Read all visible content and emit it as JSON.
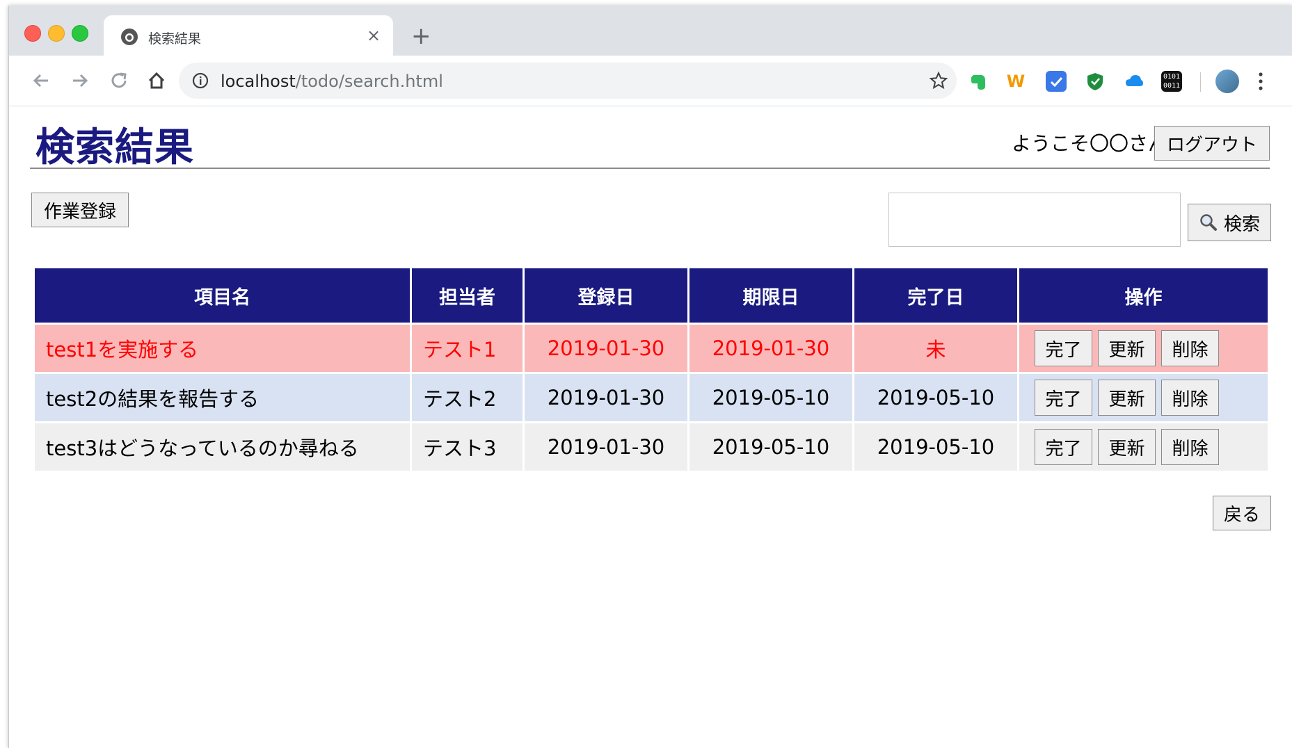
{
  "browser": {
    "tab_title": "検索結果",
    "tab_close": "×",
    "new_tab": "+",
    "url_host": "localhost",
    "url_path": "/todo/search.html",
    "ext_w_label": "W",
    "ext_binary_label": "0101 0011"
  },
  "header": {
    "title": "検索結果",
    "welcome": "ようこそ〇〇さん",
    "logout_label": "ログアウト"
  },
  "actions": {
    "register_label": "作業登録",
    "search_value": "",
    "search_label": "検索",
    "back_label": "戻る"
  },
  "table": {
    "headers": [
      "項目名",
      "担当者",
      "登録日",
      "期限日",
      "完了日",
      "操作"
    ],
    "rows": [
      {
        "item": "test1を実施する",
        "assignee": "テスト1",
        "registered": "2019-01-30",
        "due": "2019-01-30",
        "completed": "未"
      },
      {
        "item": "test2の結果を報告する",
        "assignee": "テスト2",
        "registered": "2019-01-30",
        "due": "2019-05-10",
        "completed": "2019-05-10"
      },
      {
        "item": "test3はどうなっているのか尋ねる",
        "assignee": "テスト3",
        "registered": "2019-01-30",
        "due": "2019-05-10",
        "completed": "2019-05-10"
      }
    ],
    "op_labels": {
      "complete": "完了",
      "update": "更新",
      "delete": "削除"
    }
  },
  "colors": {
    "header_bg": "#1a1a80",
    "overdue_row": "#fbb8b8",
    "overdue_text": "#ff0000",
    "even_row": "#d8e2f2",
    "odd_row": "#efefef"
  }
}
